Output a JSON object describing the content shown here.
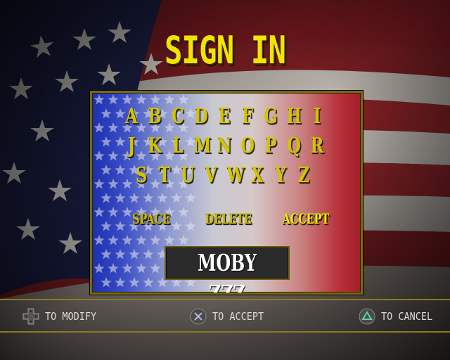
{
  "screen": {
    "title": "SIGN IN"
  },
  "keyboard": {
    "rows": [
      [
        "A",
        "B",
        "C",
        "D",
        "E",
        "F",
        "G",
        "H",
        "I"
      ],
      [
        "J",
        "K",
        "L",
        "M",
        "N",
        "O",
        "P",
        "Q",
        "R"
      ],
      [
        "S",
        "T",
        "U",
        "V",
        "W",
        "X",
        "Y",
        "Z"
      ]
    ],
    "commands": {
      "space": "SPACE",
      "delete": "DELETE",
      "accept": "ACCEPT"
    },
    "selected_command": "accept"
  },
  "name_entry": {
    "value": "MOBY ZZZ"
  },
  "footer": {
    "modify": {
      "icon": "dpad-icon",
      "label": "TO MODIFY"
    },
    "accept": {
      "icon": "cross-button-icon",
      "label": "TO ACCEPT"
    },
    "cancel": {
      "icon": "triangle-button-icon",
      "label": "TO CANCEL"
    }
  },
  "colors": {
    "title": "#f2e400",
    "letters": "#d3c300",
    "highlight": "#f2ea00",
    "frame": "#7a6a10"
  }
}
